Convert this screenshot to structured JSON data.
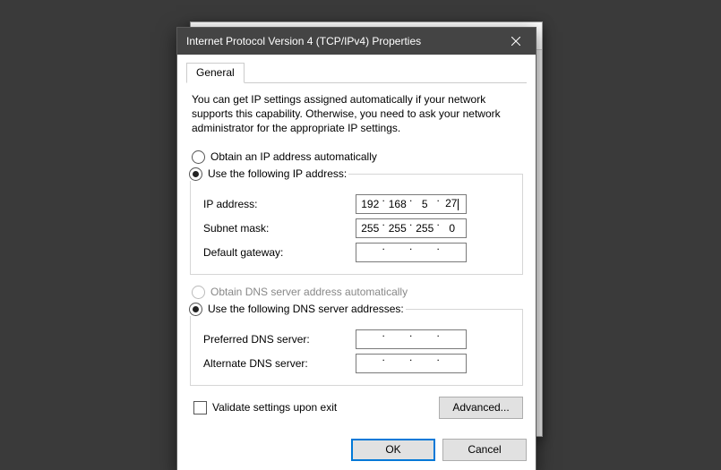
{
  "window": {
    "title": "Internet Protocol Version 4 (TCP/IPv4) Properties"
  },
  "tab": {
    "general": "General"
  },
  "intro": "You can get IP settings assigned automatically if your network supports this capability. Otherwise, you need to ask your network administrator for the appropriate IP settings.",
  "radios": {
    "auto_ip": "Obtain an IP address automatically",
    "manual_ip": "Use the following IP address:",
    "auto_dns": "Obtain DNS server address automatically",
    "manual_dns": "Use the following DNS server addresses:"
  },
  "labels": {
    "ip": "IP address:",
    "subnet": "Subnet mask:",
    "gateway": "Default gateway:",
    "preferred_dns": "Preferred DNS server:",
    "alt_dns": "Alternate DNS server:",
    "validate": "Validate settings upon exit"
  },
  "values": {
    "ip": [
      "192",
      "168",
      "5",
      "27"
    ],
    "subnet": [
      "255",
      "255",
      "255",
      "0"
    ],
    "gateway": [
      "",
      "",
      "",
      ""
    ],
    "preferred_dns": [
      "",
      "",
      "",
      ""
    ],
    "alt_dns": [
      "",
      "",
      "",
      ""
    ]
  },
  "buttons": {
    "advanced": "Advanced...",
    "ok": "OK",
    "cancel": "Cancel"
  }
}
